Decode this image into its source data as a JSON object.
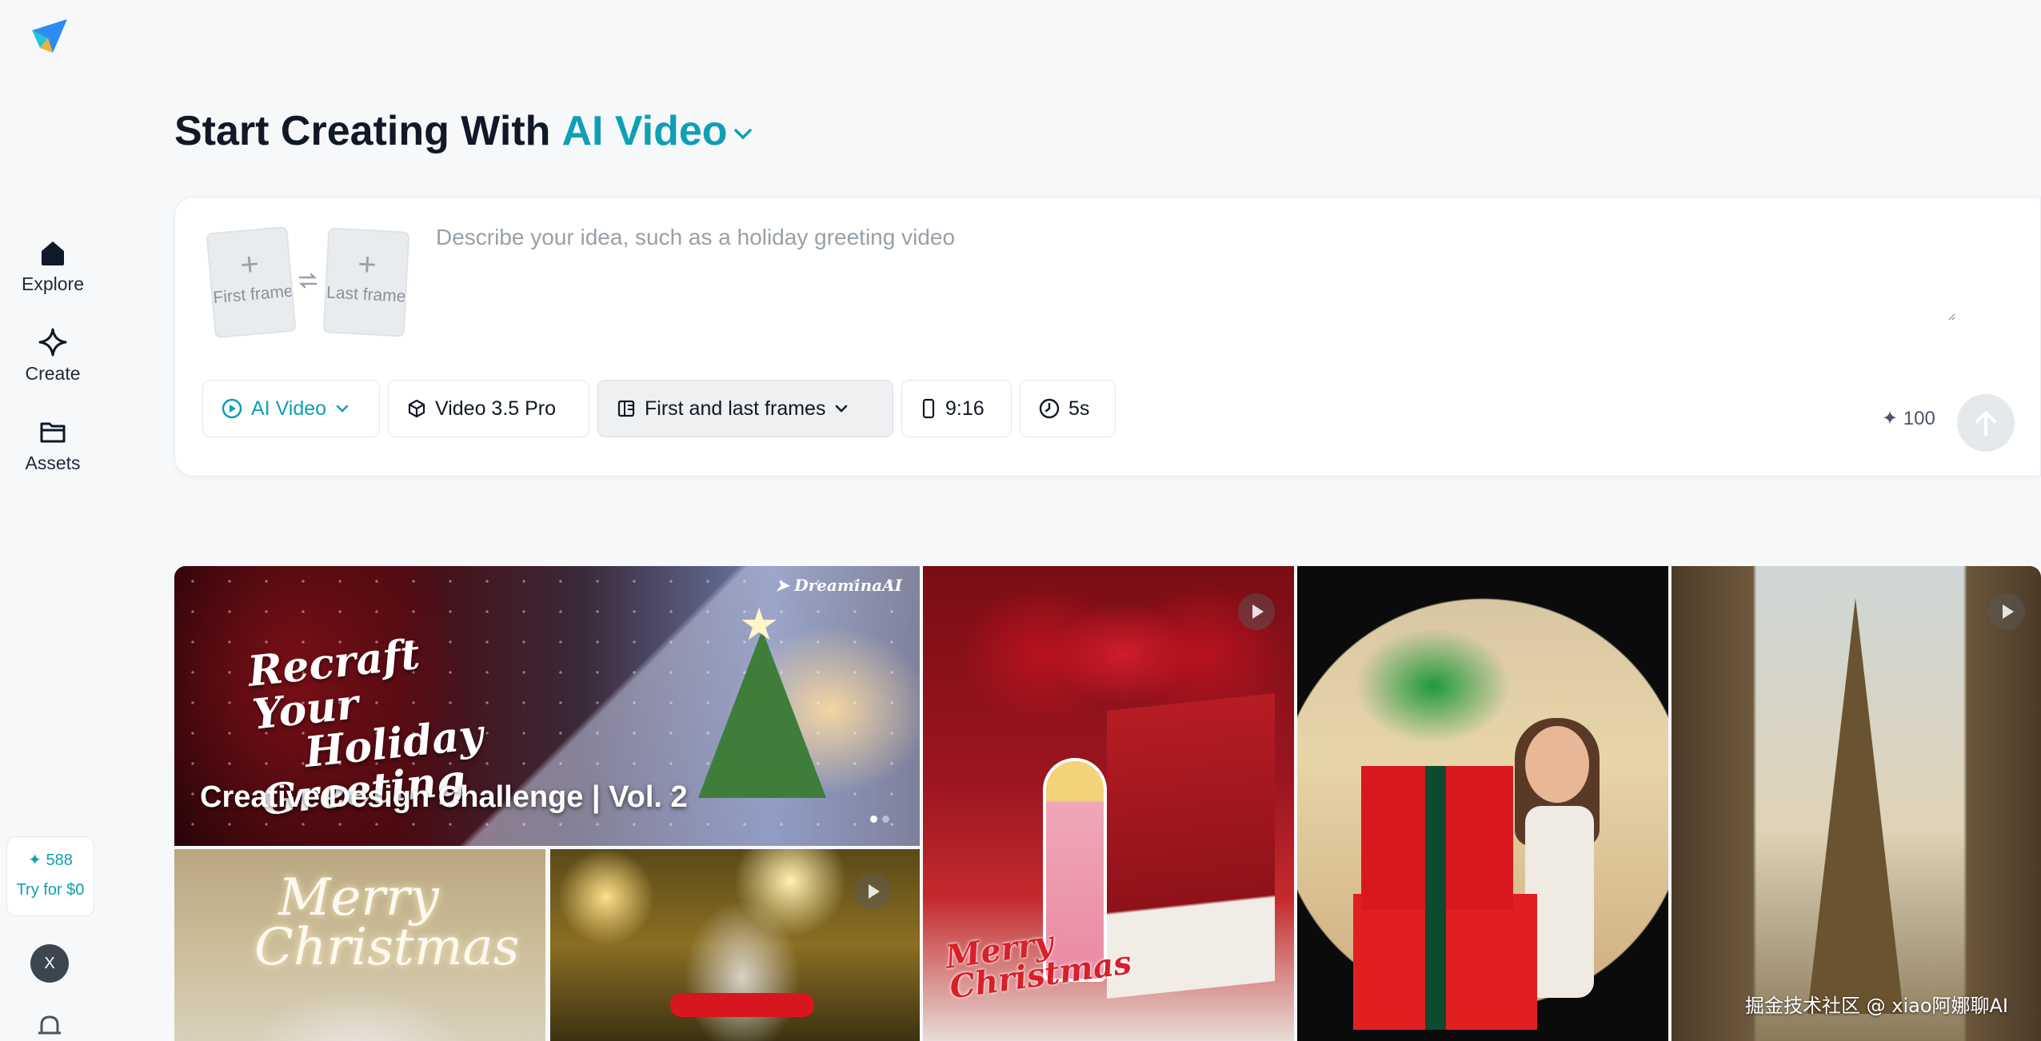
{
  "sidebar": {
    "nav": [
      {
        "label": "Explore",
        "icon": "home-icon"
      },
      {
        "label": "Create",
        "icon": "sparkle-icon"
      },
      {
        "label": "Assets",
        "icon": "folder-icon"
      }
    ],
    "credits": {
      "count": "588",
      "cta": "Try for $0"
    },
    "avatar_initial": "X"
  },
  "header": {
    "prefix": "Start Creating With",
    "mode": "AI Video"
  },
  "prompt": {
    "first_frame_label": "First frame",
    "last_frame_label": "Last frame",
    "placeholder": "Describe your idea, such as a holiday greeting video",
    "value": "",
    "chips": {
      "mode": "AI Video",
      "model": "Video 3.5 Pro",
      "frames": "First and last frames",
      "ratio": "9:16",
      "duration": "5s"
    },
    "cost": "100"
  },
  "gallery": {
    "banner": {
      "script_lines": [
        "Recraft Your",
        "Holiday",
        "Greeting"
      ],
      "brand": "DreaminaAI",
      "title": "Creative Design Challenge | Vol. 2",
      "slides_total": 2,
      "slide_active": 1
    },
    "card_script": [
      "Merry",
      "Christmas"
    ],
    "merry_script": [
      "Merry",
      "Christmas"
    ],
    "watermark": "掘金技术社区 @ xiao阿娜聊AI"
  },
  "colors": {
    "accent": "#0e9fb5",
    "background": "#f6f8fa"
  }
}
